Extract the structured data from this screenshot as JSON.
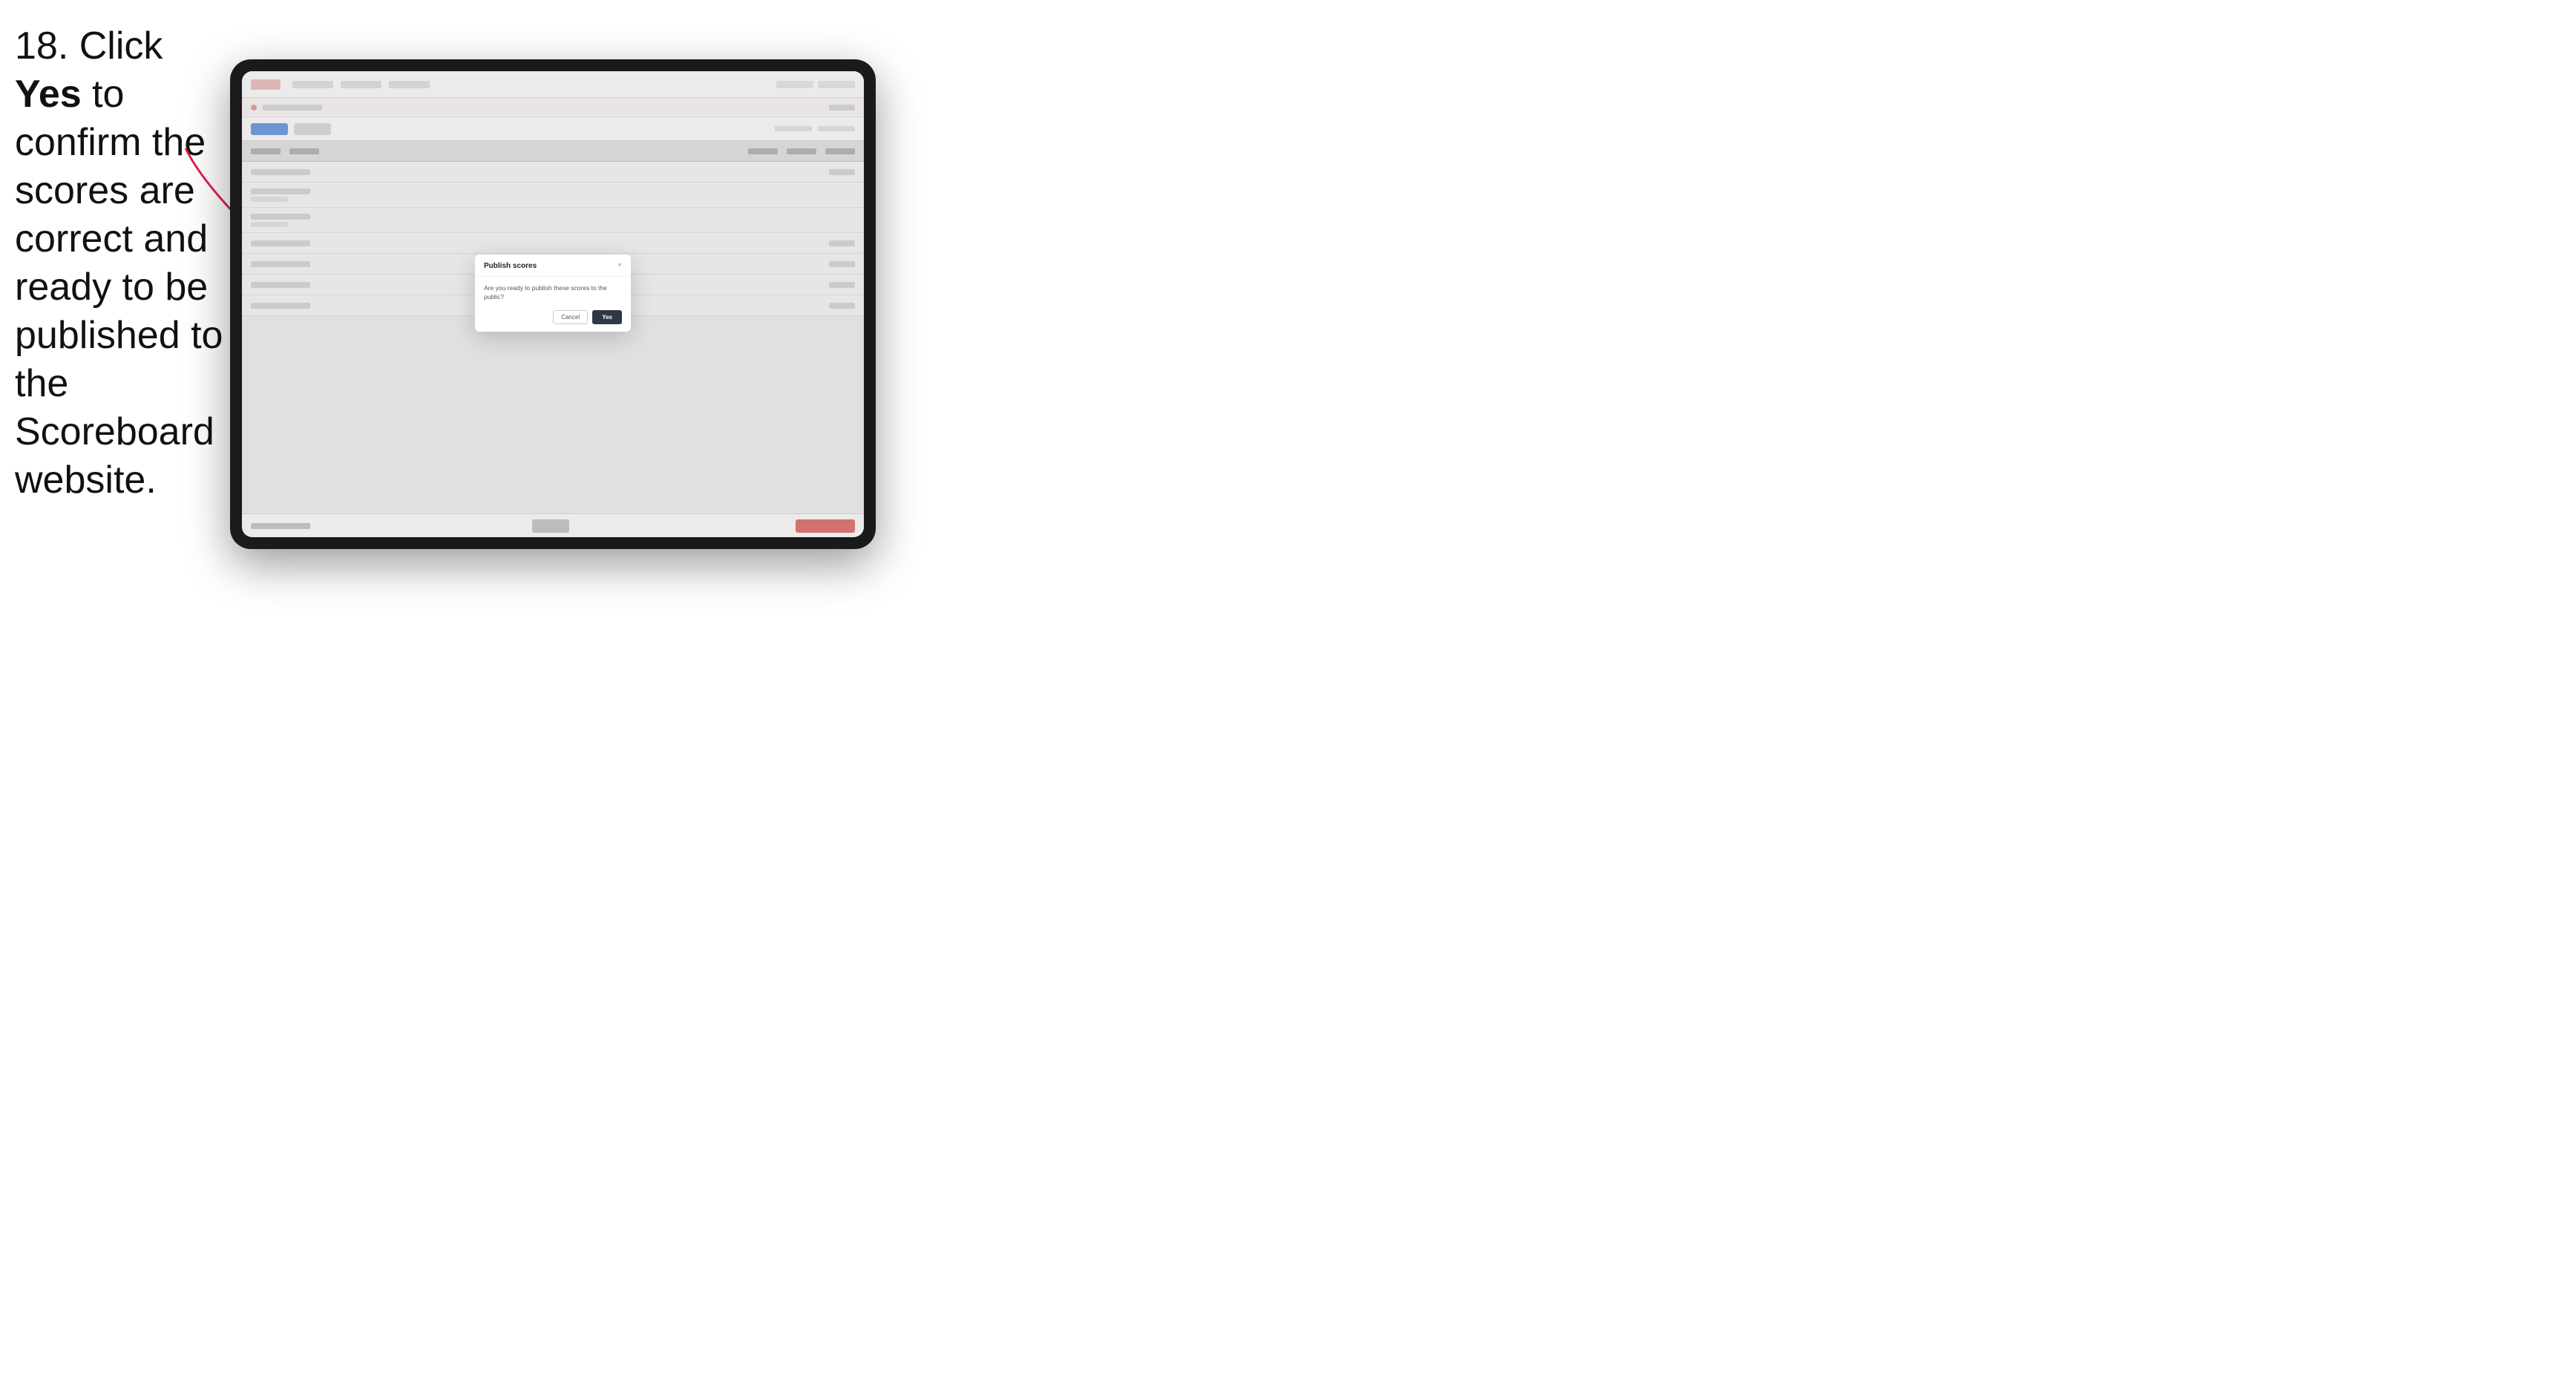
{
  "instruction": {
    "step": "18.",
    "text_before_bold": " Click ",
    "bold": "Yes",
    "text_after": " to confirm the scores are correct and ready to be published to the Scoreboard website."
  },
  "dialog": {
    "title": "Publish scores",
    "message": "Are you ready to publish these scores to the public?",
    "cancel_label": "Cancel",
    "yes_label": "Yes",
    "close_icon": "×"
  },
  "app": {
    "rows": [
      {
        "id": 1
      },
      {
        "id": 2
      },
      {
        "id": 3
      },
      {
        "id": 4
      },
      {
        "id": 5
      },
      {
        "id": 6
      },
      {
        "id": 7
      },
      {
        "id": 8
      }
    ]
  }
}
